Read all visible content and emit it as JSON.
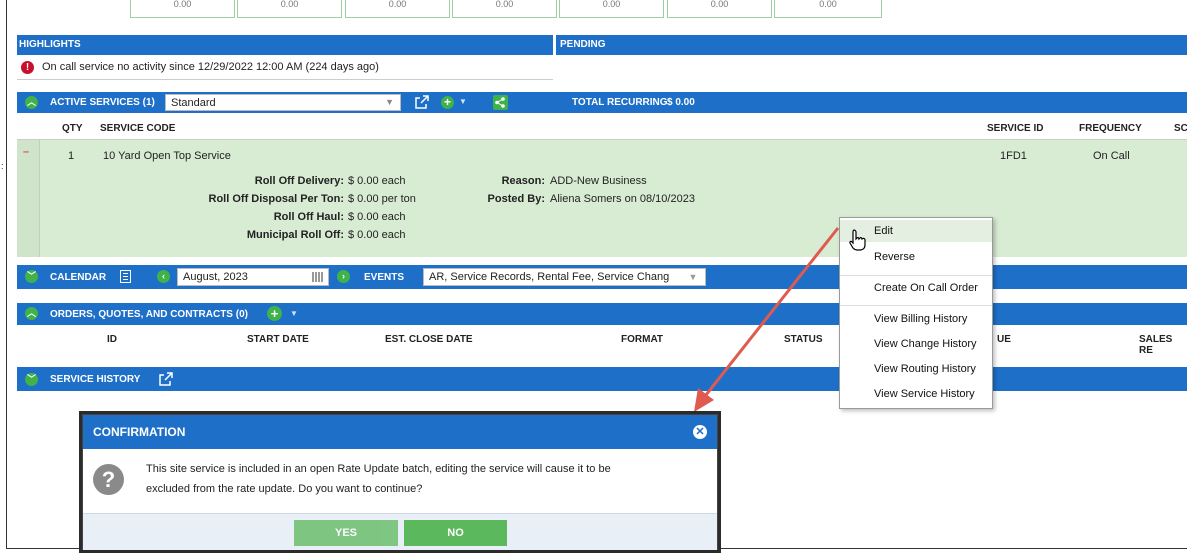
{
  "top_values": [
    "0.00",
    "0.00",
    "0.00",
    "0.00",
    "0.00",
    "0.00",
    "0.00"
  ],
  "highlights": {
    "title": "HIGHLIGHTS",
    "pending_title": "PENDING",
    "message": "On call service no activity since 12/29/2022 12:00 AM (224 days ago)"
  },
  "active_services": {
    "title": "ACTIVE SERVICES (1)",
    "dropdown_value": "Standard",
    "total_label": "TOTAL RECURRING",
    "total_value": "$ 0.00"
  },
  "service_table": {
    "headers": {
      "qty": "QTY",
      "service_code": "SERVICE CODE",
      "service_id": "SERVICE ID",
      "frequency": "FREQUENCY",
      "sc": "SC"
    },
    "row": {
      "collapse": "–",
      "qty": "1",
      "service_code": "10 Yard Open Top Service",
      "service_id": "1FD1",
      "frequency": "On Call",
      "details": [
        {
          "label": "Roll Off Delivery:",
          "value": "$ 0.00 each"
        },
        {
          "label": "Roll Off Disposal Per Ton:",
          "value": "$ 0.00 per ton"
        },
        {
          "label": "Roll Off Haul:",
          "value": "$ 0.00 each"
        },
        {
          "label": "Municipal Roll Off:",
          "value": "$ 0.00 each"
        }
      ],
      "reason_label": "Reason:",
      "reason_value": "ADD-New Business",
      "posted_label": "Posted By:",
      "posted_value": "Aliena Somers on 08/10/2023"
    }
  },
  "calendar": {
    "title": "CALENDAR",
    "month": "August, 2023",
    "events_label": "EVENTS",
    "events_value": "AR, Service Records, Rental Fee, Service Chang"
  },
  "orders": {
    "title": "ORDERS, QUOTES, AND CONTRACTS (0)",
    "headers": {
      "id": "ID",
      "start_date": "START DATE",
      "est_close": "EST. CLOSE DATE",
      "format": "FORMAT",
      "status": "STATUS",
      "ue": "UE",
      "sales": "SALES RE"
    }
  },
  "service_history": {
    "title": "SERVICE HISTORY"
  },
  "context_menu": {
    "items": [
      "Edit",
      "Reverse",
      "Create On Call Order",
      "View Billing History",
      "View Change History",
      "View Routing History",
      "View Service History"
    ]
  },
  "confirmation": {
    "title": "CONFIRMATION",
    "line1": "This site service is included in an open Rate Update batch, editing the service will cause it to be",
    "line2": "excluded from the rate update. Do you want to continue?",
    "yes": "YES",
    "no": "NO"
  },
  "colors": {
    "accent_blue": "#1e6fc8",
    "green": "#3fb34a",
    "row_green": "#d8ebd3",
    "arrow": "#e05a4f"
  }
}
